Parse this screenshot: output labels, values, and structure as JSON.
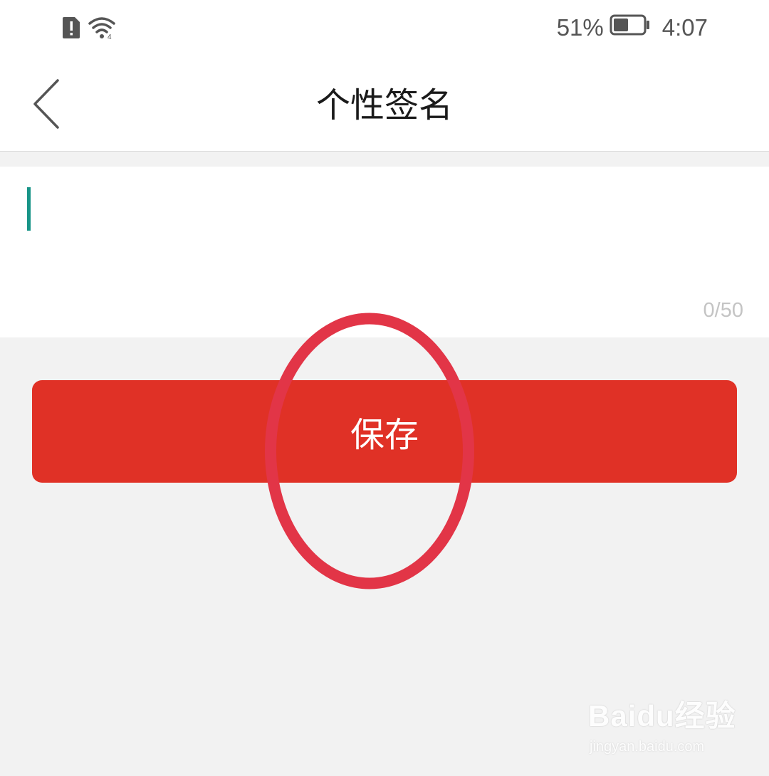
{
  "status_bar": {
    "battery_percent": "51%",
    "battery_level": 0.51,
    "time": "4:07",
    "icons": [
      "sim-alert-icon",
      "wifi-icon",
      "battery-icon"
    ]
  },
  "nav": {
    "back_icon": "chevron-left-icon",
    "title": "个性签名"
  },
  "editor": {
    "value": "",
    "char_counter": "0/50",
    "caret_color": "#179487"
  },
  "save_button": {
    "label": "保存",
    "color": "#e03126"
  },
  "annotation": {
    "highlight_color": "#e23547"
  },
  "watermark": {
    "logo_text": "Baidu经验",
    "url": "jingyan.baidu.com"
  }
}
